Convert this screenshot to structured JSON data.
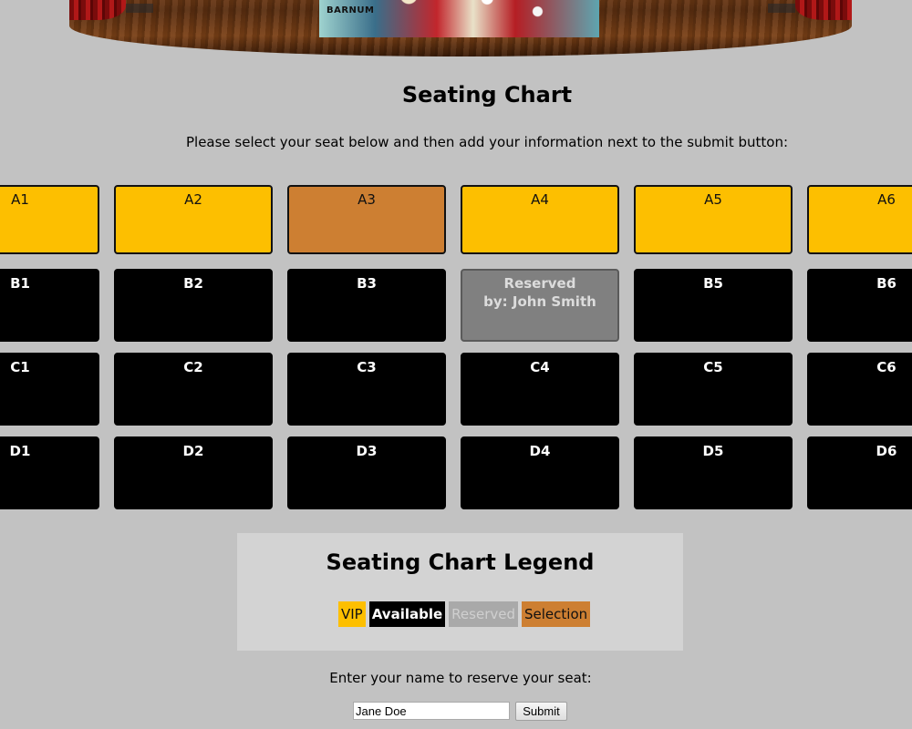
{
  "header": {
    "poster_text": "BARNUM",
    "title": "Seating Chart",
    "instructions": "Please select your seat below and then add your information next to the submit button:"
  },
  "seat_rows": [
    {
      "row": "A",
      "seats": [
        {
          "label": "A1",
          "status": "vip"
        },
        {
          "label": "A2",
          "status": "vip"
        },
        {
          "label": "A3",
          "status": "selected"
        },
        {
          "label": "A4",
          "status": "vip"
        },
        {
          "label": "A5",
          "status": "vip"
        },
        {
          "label": "A6",
          "status": "vip"
        }
      ]
    },
    {
      "row": "B",
      "seats": [
        {
          "label": "B1",
          "status": "available"
        },
        {
          "label": "B2",
          "status": "available"
        },
        {
          "label": "B3",
          "status": "available"
        },
        {
          "label": "Reserved",
          "sublabel": "by: John Smith",
          "status": "reserved"
        },
        {
          "label": "B5",
          "status": "available"
        },
        {
          "label": "B6",
          "status": "available"
        }
      ]
    },
    {
      "row": "C",
      "seats": [
        {
          "label": "C1",
          "status": "available"
        },
        {
          "label": "C2",
          "status": "available"
        },
        {
          "label": "C3",
          "status": "available"
        },
        {
          "label": "C4",
          "status": "available"
        },
        {
          "label": "C5",
          "status": "available"
        },
        {
          "label": "C6",
          "status": "available"
        }
      ]
    },
    {
      "row": "D",
      "seats": [
        {
          "label": "D1",
          "status": "available"
        },
        {
          "label": "D2",
          "status": "available"
        },
        {
          "label": "D3",
          "status": "available"
        },
        {
          "label": "D4",
          "status": "available"
        },
        {
          "label": "D5",
          "status": "available"
        },
        {
          "label": "D6",
          "status": "available"
        }
      ]
    }
  ],
  "legend": {
    "title": "Seating Chart Legend",
    "items": [
      {
        "label": "VIP",
        "color": "#fdbf00"
      },
      {
        "label": "Available",
        "color": "#000000"
      },
      {
        "label": "Reserved",
        "color": "#a9a9a9"
      },
      {
        "label": "Selection",
        "color": "#cd7f32"
      }
    ]
  },
  "form": {
    "prompt": "Enter your name to reserve your seat:",
    "name_value": "Jane Doe",
    "submit_label": "Submit"
  },
  "colors": {
    "background": "#c2c2c2",
    "vip": "#fdbf00",
    "selected": "#cd7f32",
    "available": "#000000",
    "reserved": "#808080"
  }
}
